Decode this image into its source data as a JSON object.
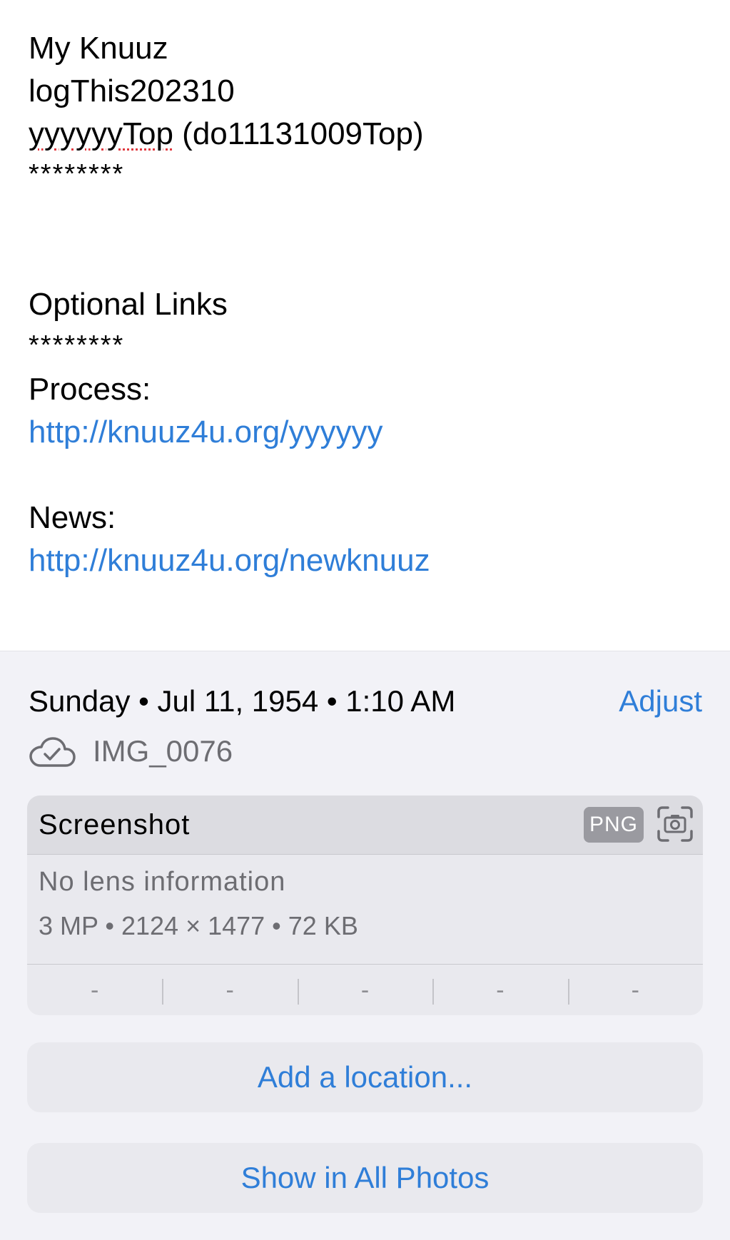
{
  "caption": {
    "line1": "My Knuuz",
    "line2": "logThis202310",
    "line3_misspelled": "yyyyyyTop",
    "line3_rest": " (do11131009Top)",
    "stars1": "********",
    "optional_heading": "Optional Links",
    "stars2": "********",
    "process_label": "Process:",
    "process_link": "http://knuuz4u.org/yyyyyy",
    "news_label": "News:",
    "news_link": "http://knuuz4u.org/newknuuz"
  },
  "info": {
    "datetime": "Sunday • Jul 11, 1954 • 1:10 AM",
    "adjust_label": "Adjust",
    "file_name": "IMG_0076",
    "cloud_icon": "icloud-synced-icon"
  },
  "metadata": {
    "title": "Screenshot",
    "format_badge": "PNG",
    "camera_icon": "screenshot-camera-icon",
    "lens": "No lens information",
    "size_line": "3 MP  •  2124 × 1477  •  72 KB",
    "exif": [
      "-",
      "-",
      "-",
      "-",
      "-"
    ]
  },
  "actions": {
    "add_location": "Add a location...",
    "show_all_photos": "Show in All Photos"
  },
  "colors": {
    "link": "#2f7ed8",
    "panel_bg": "#f2f2f7",
    "card_bg": "#e9e9ee",
    "secondary_text": "#6d6d72"
  }
}
